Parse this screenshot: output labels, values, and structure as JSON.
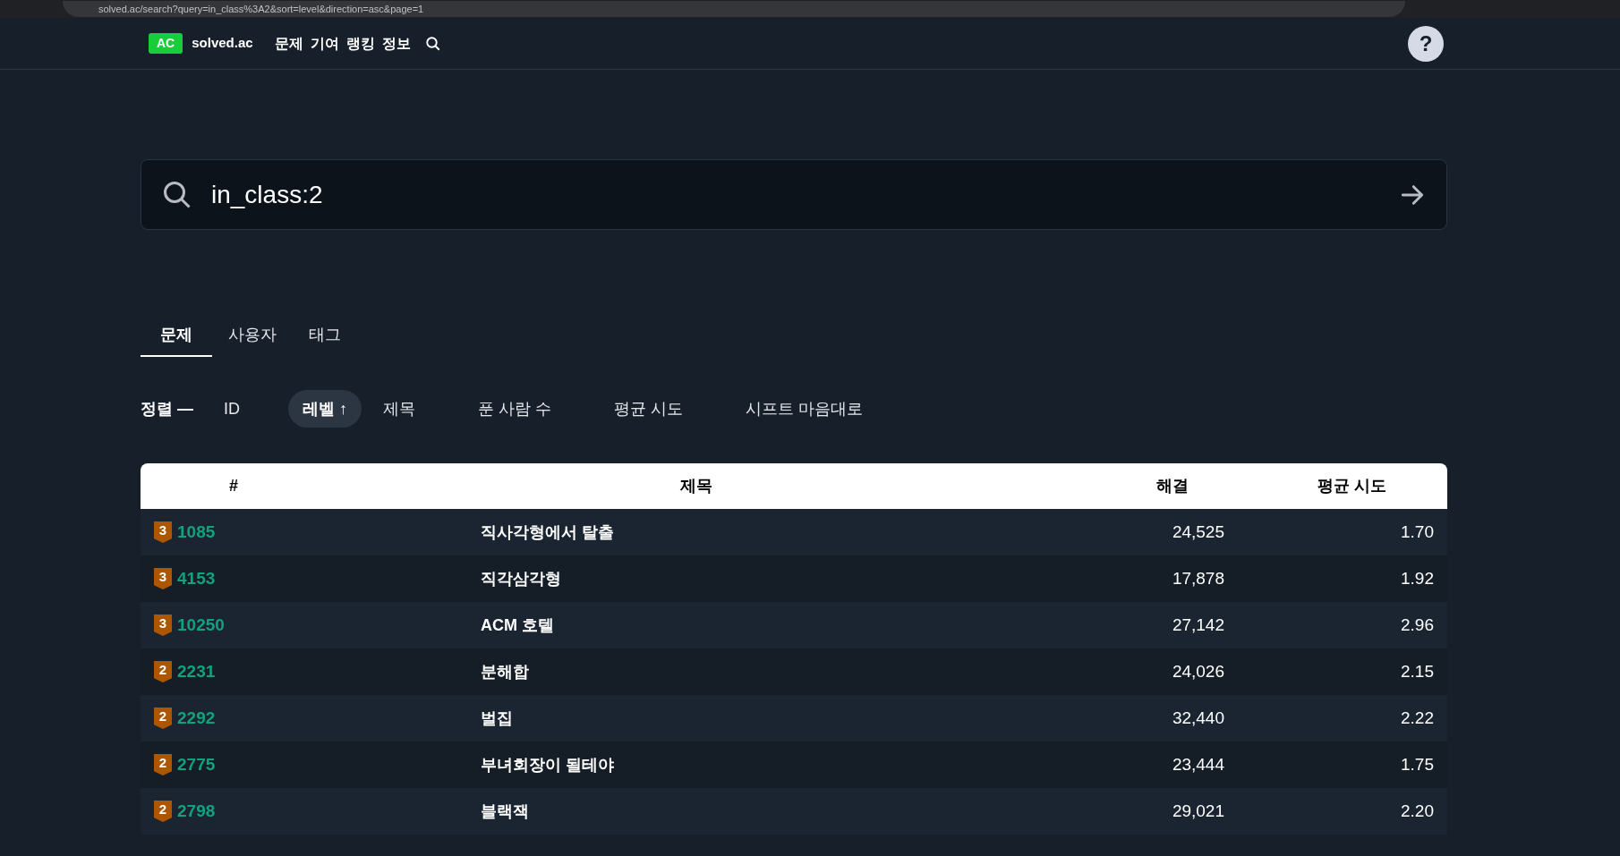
{
  "browser": {
    "url": "solved.ac/search?query=in_class%3A2&sort=level&direction=asc&page=1"
  },
  "nav": {
    "logo_badge": "AC",
    "logo_text": "solved.ac",
    "links": [
      "문제",
      "기여",
      "랭킹",
      "정보"
    ],
    "help": "?"
  },
  "search": {
    "value": "in_class:2"
  },
  "tabs": [
    {
      "label": "문제",
      "selected": true
    },
    {
      "label": "사용자",
      "selected": false
    },
    {
      "label": "태그",
      "selected": false
    }
  ],
  "sort": {
    "label": "정렬 —",
    "options": [
      {
        "label": "ID",
        "selected": false
      },
      {
        "label": "레벨 ↑",
        "selected": true
      },
      {
        "label": "제목",
        "selected": false
      },
      {
        "label": "푼 사람 수",
        "selected": false
      },
      {
        "label": "평균 시도",
        "selected": false
      },
      {
        "label": "시프트 마음대로",
        "selected": false
      }
    ]
  },
  "table": {
    "columns": [
      "#",
      "제목",
      "해결",
      "평균 시도"
    ],
    "rows": [
      {
        "tier": "3",
        "id": "1085",
        "title": "직사각형에서 탈출",
        "solved": "24,525",
        "avg": "1.70"
      },
      {
        "tier": "3",
        "id": "4153",
        "title": "직각삼각형",
        "solved": "17,878",
        "avg": "1.92"
      },
      {
        "tier": "3",
        "id": "10250",
        "title": "ACM 호텔",
        "solved": "27,142",
        "avg": "2.96"
      },
      {
        "tier": "2",
        "id": "2231",
        "title": "분해합",
        "solved": "24,026",
        "avg": "2.15"
      },
      {
        "tier": "2",
        "id": "2292",
        "title": "벌집",
        "solved": "32,440",
        "avg": "2.22"
      },
      {
        "tier": "2",
        "id": "2775",
        "title": "부녀회장이 될테야",
        "solved": "23,444",
        "avg": "1.75"
      },
      {
        "tier": "2",
        "id": "2798",
        "title": "블랙잭",
        "solved": "29,021",
        "avg": "2.20"
      }
    ]
  }
}
